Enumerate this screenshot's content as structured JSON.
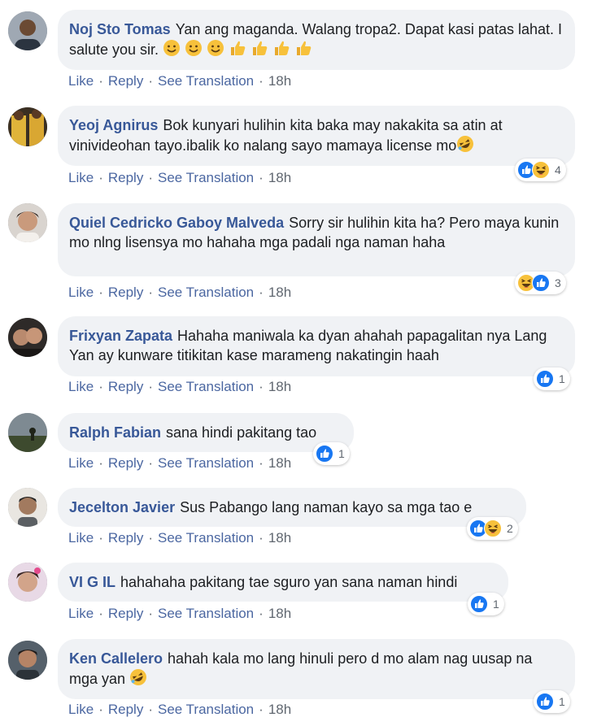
{
  "actions": {
    "like": "Like",
    "reply": "Reply",
    "see_translation": "See Translation",
    "separator": "·"
  },
  "comments": [
    {
      "author": "Noj Sto Tomas",
      "text": "Yan ang maganda. Walang tropa2. Dapat kasi patas lahat. I salute you sir.",
      "emojis": [
        "smiling-face-icon",
        "smiling-face-icon",
        "smiling-face-icon",
        "thumbs-up-icon",
        "thumbs-up-icon",
        "thumbs-up-icon",
        "thumbs-up-icon"
      ],
      "time": "18h",
      "reactions": [],
      "reaction_count": ""
    },
    {
      "author": "Yeoj Agnirus",
      "text": "Bok kunyari hulihin kita baka may nakakita sa atin at vinivideohan tayo.ibalik ko nalang sayo mamaya license mo",
      "emojis": [
        "rolling-laugh-icon"
      ],
      "time": "18h",
      "reactions": [
        "like-reaction-icon",
        "haha-reaction-icon"
      ],
      "reaction_count": "4"
    },
    {
      "author": "Quiel Cedricko Gaboy Malveda",
      "text": "Sorry sir hulihin kita ha? Pero maya kunin mo nlng lisensya mo hahaha mga padali nga naman haha",
      "emojis": [],
      "time": "18h",
      "reactions": [
        "haha-reaction-icon",
        "like-reaction-icon"
      ],
      "reaction_count": "3"
    },
    {
      "author": "Frixyan Zapata",
      "text": "Hahaha maniwala ka dyan ahahah papagalitan nya Lang Yan ay kunware titikitan kase marameng nakatingin haah",
      "emojis": [],
      "time": "18h",
      "reactions": [
        "like-reaction-icon"
      ],
      "reaction_count": "1"
    },
    {
      "author": "Ralph Fabian",
      "text": "sana hindi pakitang tao",
      "emojis": [],
      "time": "18h",
      "reactions": [
        "like-reaction-icon"
      ],
      "reaction_count": "1"
    },
    {
      "author": "Jecelton Javier",
      "text": "Sus Pabango lang naman kayo sa mga tao e",
      "emojis": [],
      "time": "18h",
      "reactions": [
        "like-reaction-icon",
        "haha-reaction-icon"
      ],
      "reaction_count": "2"
    },
    {
      "author": "VI G IL",
      "text": "hahahaha pakitang tae sguro yan sana naman hindi",
      "emojis": [],
      "time": "18h",
      "reactions": [
        "like-reaction-icon"
      ],
      "reaction_count": "1"
    },
    {
      "author": "Ken Callelero",
      "text": "hahah kala mo lang hinuli pero d mo alam nag uusap na mga yan",
      "emojis": [
        "rolling-laugh-icon"
      ],
      "time": "18h",
      "reactions": [
        "like-reaction-icon"
      ],
      "reaction_count": "1"
    }
  ]
}
